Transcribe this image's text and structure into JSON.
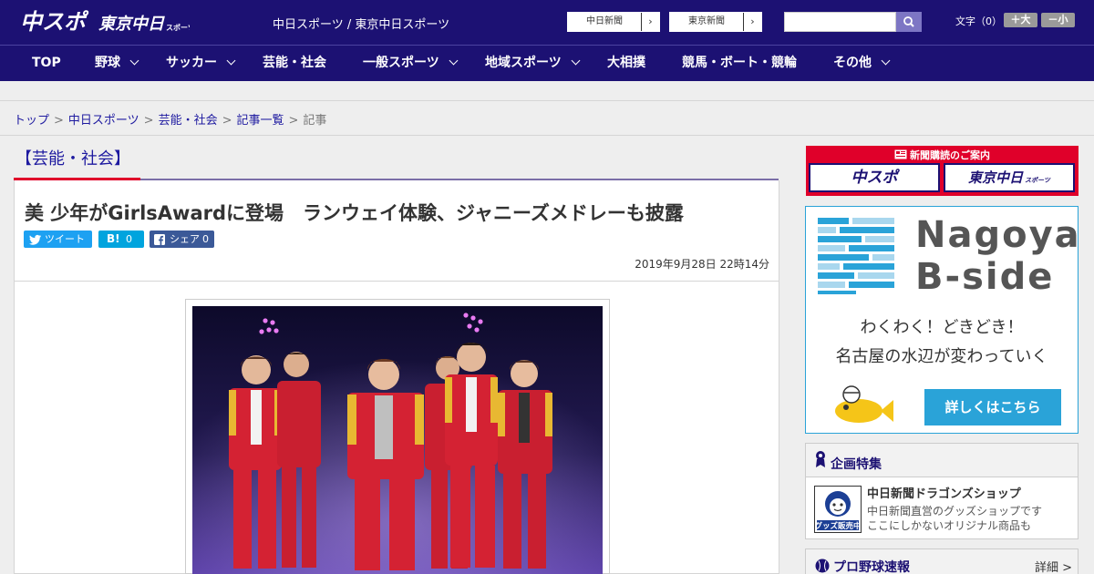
{
  "header": {
    "logo_chuspo": "中スポ",
    "logo_tokyo_main": "東京中日",
    "logo_tokyo_sub": "スポーツ",
    "site_link": "中日スポーツ / 東京中日スポーツ",
    "paper_links": [
      "中日新聞",
      "東京新聞"
    ],
    "arrow": "›",
    "search": {
      "placeholder": ""
    },
    "font_size_label": "文字（0）",
    "font_bigger": "＋大",
    "font_smaller": "－小"
  },
  "nav": {
    "items": [
      {
        "label": "TOP",
        "dropdown": false
      },
      {
        "label": "野球",
        "dropdown": true
      },
      {
        "label": "サッカー",
        "dropdown": true
      },
      {
        "label": "芸能・社会",
        "dropdown": false
      },
      {
        "label": "一般スポーツ",
        "dropdown": true
      },
      {
        "label": "地域スポーツ",
        "dropdown": true
      },
      {
        "label": "大相撲",
        "dropdown": false
      },
      {
        "label": "競馬・ボート・競輪",
        "dropdown": false
      },
      {
        "label": "その他",
        "dropdown": true
      }
    ]
  },
  "breadcrumb": {
    "items": [
      "トップ",
      "中日スポーツ",
      "芸能・社会",
      "記事一覧",
      "記事"
    ],
    "separator": ">"
  },
  "category_title": "【芸能・社会】",
  "article": {
    "headline": "美 少年がGirlsAwardに登場　ランウェイ体験、ジャニーズメドレーも披露",
    "share": {
      "tweet_label": "ツイート",
      "hatena_label": "B!",
      "hatena_count": "0",
      "facebook_label": "シェア",
      "facebook_count": "0"
    },
    "date": "2019年9月28日 22時14分"
  },
  "sidebar": {
    "subscription": {
      "title": "新聞購読のご案内",
      "chuspo_label": "中スポ",
      "tokyo_label": "東京中日",
      "tokyo_sub": "スポーツ"
    },
    "bside": {
      "title_line1": "Nagoya",
      "title_line2": "B-side",
      "catch1": "わくわく！どきどき！",
      "catch2": "名古屋の水辺が変わっていく",
      "cta": "詳しくはこちら"
    },
    "special": {
      "title": "企画特集",
      "thumb_caption": "グッズ販売中",
      "shop_name": "中日新聞ドラゴンズショップ",
      "shop_desc1": "中日新聞直営のグッズショップです",
      "shop_desc2": "ここにしかないオリジナル商品も"
    },
    "baseball": {
      "title": "プロ野球速報",
      "more": "詳細 >"
    }
  },
  "colors": {
    "navy": "#1c1173",
    "accent_red": "#e0002a",
    "link_blue": "#1e1aa0",
    "twitter": "#1da1f2",
    "hatena": "#00a4de",
    "facebook": "#3b5998",
    "bside_blue": "#2aa3d8"
  }
}
